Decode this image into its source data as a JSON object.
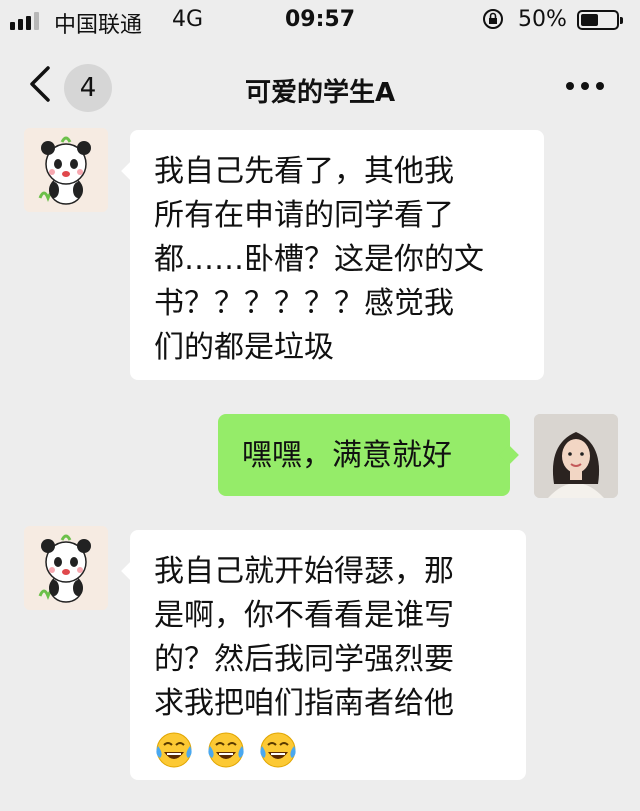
{
  "status_bar": {
    "carrier": "中国联通",
    "network": "4G",
    "time": "09:57",
    "battery_percent": "50%",
    "battery_level": 0.5
  },
  "nav": {
    "back_icon": "chevron-left-icon",
    "unread_count": "4",
    "title": "可爱的学生A",
    "more_icon": "more-dots-icon"
  },
  "messages": [
    {
      "direction": "incoming",
      "avatar": "panda-avatar",
      "lines": [
        "我自己先看了，其他我",
        "所有在申请的同学看了",
        "都……卧槽？这是你的文",
        "书？？？？？？感觉我",
        "们的都是垃圾"
      ]
    },
    {
      "direction": "outgoing",
      "avatar": "woman-avatar",
      "lines": [
        "嘿嘿，满意就好"
      ]
    },
    {
      "direction": "incoming",
      "avatar": "panda-avatar",
      "lines": [
        "我自己就开始得瑟，那",
        "是啊，你不看看是谁写",
        "的？然后我同学强烈要",
        "求我把咱们指南者给他"
      ],
      "emojis": [
        "tears-of-joy-emoji",
        "tears-of-joy-emoji",
        "tears-of-joy-emoji"
      ]
    }
  ],
  "colors": {
    "background": "#ededed",
    "incoming_bubble": "#ffffff",
    "outgoing_bubble": "#95ec69"
  }
}
